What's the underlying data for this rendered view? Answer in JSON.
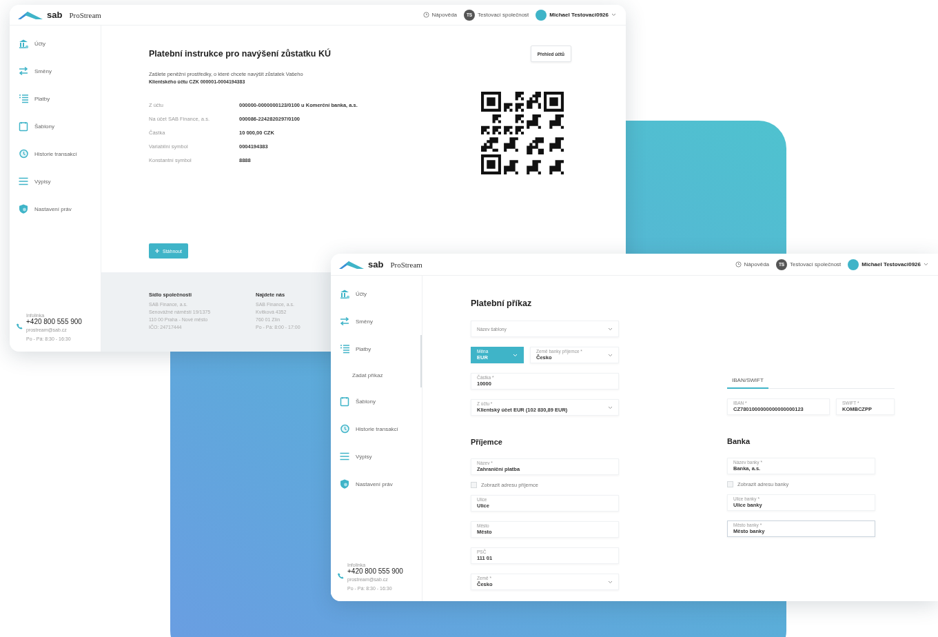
{
  "windows": [
    {
      "kind": "instructions",
      "logo": {
        "brand": "sab",
        "product": "ProStream"
      },
      "header": {
        "help": "Nápověda",
        "company_initials": "TS",
        "company": "Testovací společnost",
        "user": "Michael Testovaci0926"
      },
      "sidebar": {
        "items": [
          {
            "label": "Účty"
          },
          {
            "label": "Směny"
          },
          {
            "label": "Platby"
          },
          {
            "label": "Šablony"
          },
          {
            "label": "Historie transakcí"
          },
          {
            "label": "Výpisy"
          },
          {
            "label": "Nastavení práv"
          }
        ],
        "contact": {
          "label": "Infolinka",
          "phone": "+420 800 555 900",
          "email": "prostream@sab.cz",
          "hours": "Po - Pá: 8:30 - 16:30"
        }
      },
      "content": {
        "title": "Platební instrukce pro navýšení zůstatku KÚ",
        "overview_button": "Přehled účtů",
        "intro": "Zašlete peněžní prostředky, o které chcete navýšit zůstatek Vašeho",
        "account_line": "Klientského účtu CZK 000001-0004194383",
        "details": [
          {
            "label": "Z účtu",
            "value": "000000-0000000123/0100 u Komerční banka, a.s."
          },
          {
            "label": "Na účet SAB Finance, a.s.",
            "value": "000086-2242820297/0100"
          },
          {
            "label": "Částka",
            "value": "10 000,00 CZK"
          },
          {
            "label": "Variabilní symbol",
            "value": "0004194383"
          },
          {
            "label": "Konstantní symbol",
            "value": "8888"
          }
        ],
        "download_button": "Stáhnout"
      },
      "footer": [
        {
          "title": "Sídlo společnosti",
          "lines": [
            "SAB Finance, a.s.",
            "Senovážné náměstí 19/1375",
            "110 00 Praha - Nové město",
            "IČO: 24717444"
          ]
        },
        {
          "title": "Najdete nás",
          "lines": [
            "SAB Finance, a.s.",
            "Kvítková 4352",
            "760 01 Zlín",
            "Po - Pá: 8:00 - 17:00"
          ]
        }
      ]
    },
    {
      "kind": "payment_order",
      "logo": {
        "brand": "sab",
        "product": "ProStream"
      },
      "header": {
        "help": "Nápověda",
        "company_initials": "TS",
        "company": "Testovací společnost",
        "user": "Michael Testovaci0926"
      },
      "sidebar": {
        "items": [
          {
            "label": "Účty",
            "expanded": false
          },
          {
            "label": "Směny",
            "expanded": false
          },
          {
            "label": "Platby",
            "expanded": true,
            "children": [
              {
                "label": "Zadat příkaz"
              }
            ]
          },
          {
            "label": "Šablony",
            "expanded": false
          },
          {
            "label": "Historie transakcí",
            "expanded": false
          },
          {
            "label": "Výpisy",
            "expanded": false
          },
          {
            "label": "Nastavení práv",
            "expanded": false
          }
        ],
        "contact": {
          "label": "Infolinka",
          "phone": "+420 800 555 900",
          "email": "prostream@sab.cz",
          "hours": "Po - Pá: 8:30 - 16:30"
        }
      },
      "form": {
        "title": "Platební příkaz",
        "left": [
          {
            "kind": "select",
            "placeholder": "Název šablony",
            "highlighted": false,
            "focused": false
          },
          {
            "kind": "row",
            "fields": [
              {
                "kind": "select",
                "label": "Měna",
                "value": "EUR",
                "highlighted": true,
                "focused": false
              },
              {
                "kind": "select",
                "label": "Země banky příjemce *",
                "value": "Česko",
                "highlighted": false,
                "focused": false
              }
            ]
          },
          {
            "kind": "row",
            "fields": [
              {
                "kind": "input",
                "label": "Částka *",
                "value": "10000",
                "highlighted": false,
                "focused": false
              }
            ]
          },
          {
            "kind": "select",
            "label": "Z účtu *",
            "value": "Klientský účet EUR (102 830,89 EUR)",
            "highlighted": false,
            "focused": false
          },
          {
            "kind": "heading",
            "text": "Příjemce"
          },
          {
            "kind": "input",
            "label": "Název *",
            "value": "Zahraniční platba",
            "highlighted": false,
            "focused": false
          },
          {
            "kind": "checkbox",
            "label": "Zobrazit adresu příjemce",
            "checked": false
          },
          {
            "kind": "input",
            "label": "Ulice",
            "value": "Ulice",
            "highlighted": false,
            "focused": false
          },
          {
            "kind": "input",
            "label": "Město",
            "value": "Město",
            "highlighted": false,
            "focused": false
          },
          {
            "kind": "input",
            "label": "PSČ",
            "value": "111 01",
            "highlighted": false,
            "focused": false
          },
          {
            "kind": "row",
            "fields": [
              {
                "kind": "select",
                "label": "Země *",
                "value": "Česko",
                "highlighted": false,
                "focused": false
              }
            ]
          }
        ],
        "right": [
          {
            "kind": "tabs",
            "tabs": [
              {
                "label": "IBAN/SWIFT",
                "selected": true
              }
            ]
          },
          {
            "kind": "row",
            "fields": [
              {
                "kind": "input",
                "label": "IBAN *",
                "value": "CZ7801000000000000000123",
                "highlighted": false,
                "focused": false
              },
              {
                "kind": "input",
                "label": "SWIFT *",
                "value": "KOMBCZPP",
                "highlighted": false,
                "focused": false
              }
            ]
          },
          {
            "kind": "heading",
            "text": "Banka"
          },
          {
            "kind": "input",
            "label": "Název banky *",
            "value": "Banka, a.s.",
            "highlighted": false,
            "focused": false
          },
          {
            "kind": "checkbox",
            "label": "Zobrazit adresu banky",
            "checked": false
          },
          {
            "kind": "input",
            "label": "Ulice banky *",
            "value": "Ulice banky",
            "highlighted": false,
            "focused": false
          },
          {
            "kind": "input",
            "label": "Město banky *",
            "value": "Město banky",
            "highlighted": false,
            "focused": true
          }
        ]
      }
    }
  ]
}
